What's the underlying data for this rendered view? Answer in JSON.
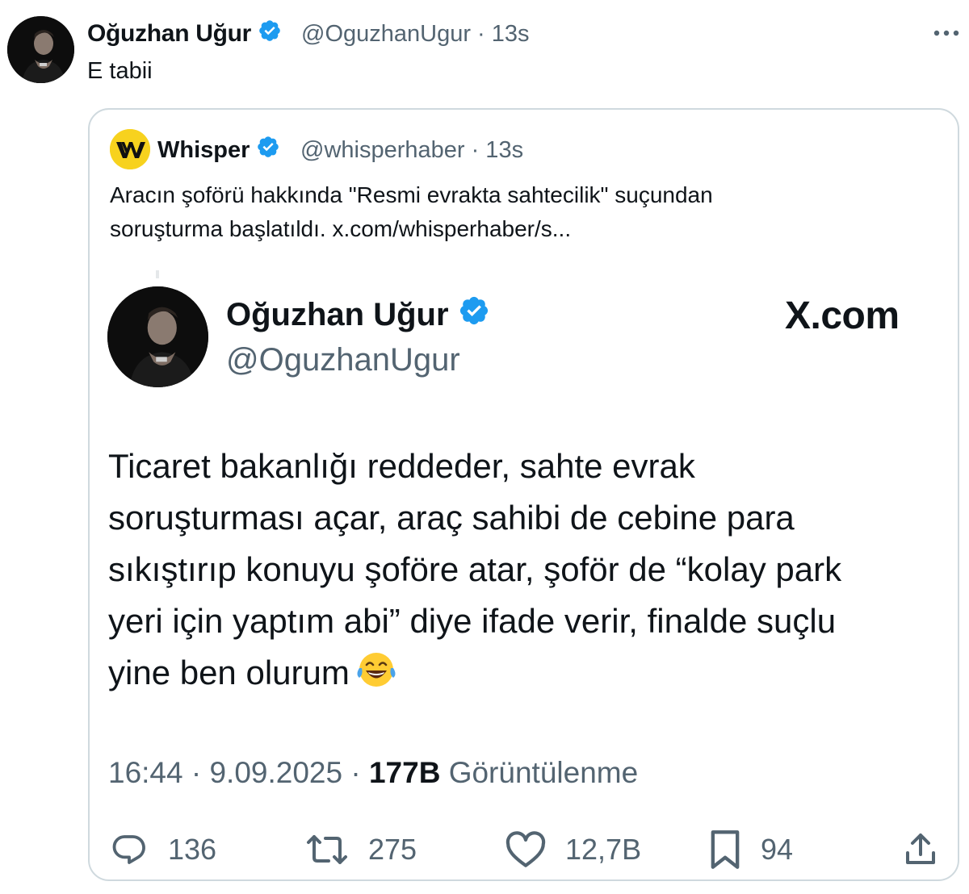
{
  "tweet": {
    "author_name": "Oğuzhan Uğur",
    "handle_time": "@OguzhanUgur · 13s",
    "text": "E tabii",
    "more_icon": "more-horizontal-icon"
  },
  "quote": {
    "author_name": "Whisper",
    "handle_time": "@whisperhaber · 13s",
    "text_line1": "Aracın şoförü hakkında \"Resmi evrakta sahtecilik\" suçundan",
    "text_line2": "soruşturma başlatıldı.  x.com/whisperhaber/s..."
  },
  "embedded": {
    "author_name": "Oğuzhan Uğur",
    "handle": "@OguzhanUgur",
    "brand": "X.com",
    "body_lines": [
      "Ticaret bakanlığı reddeder, sahte evrak",
      "soruşturması açar, araç sahibi de cebine para",
      "sıkıştırıp konuyu şoföre atar, şoför de “kolay park",
      "yeri için yaptım abi” diye ifade verir, finalde suçlu",
      "yine ben olurum"
    ],
    "time_date": "16:44 · 9.09.2025 · ",
    "views_count": "177B",
    "views_label": " Görüntülenme",
    "actions": {
      "replies": "136",
      "reposts": "275",
      "likes": "12,7B",
      "bookmarks": "94"
    }
  },
  "colors": {
    "verified": "#1d9bf0",
    "secondary_text": "#536471",
    "border": "#cfd9de",
    "whisper_yellow": "#f7d21e"
  }
}
